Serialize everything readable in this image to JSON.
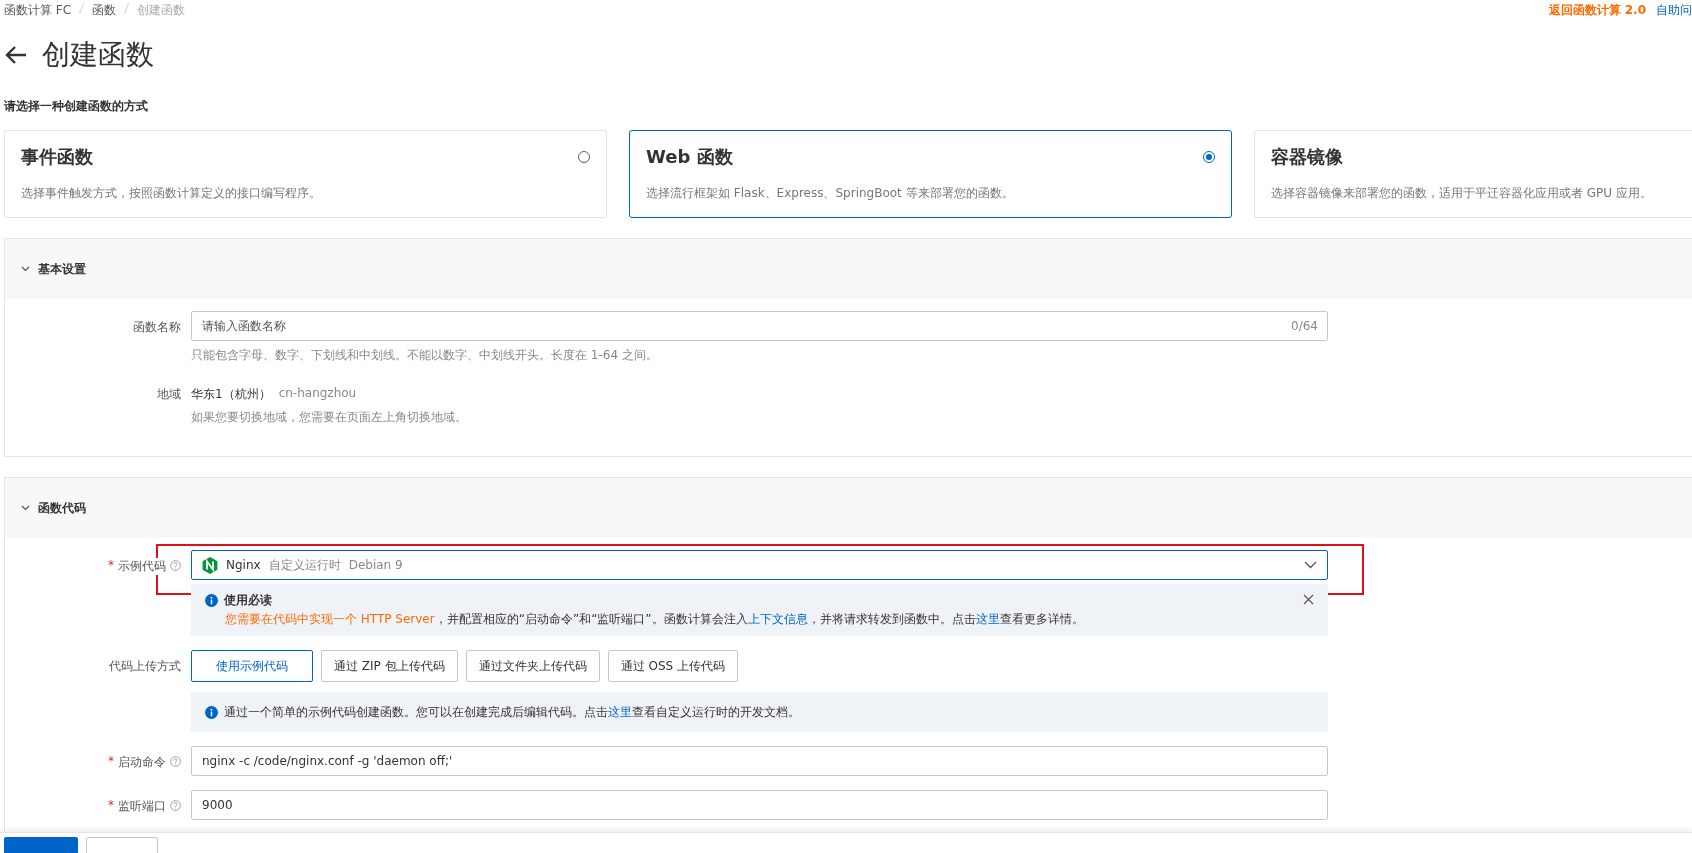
{
  "breadcrumb": [
    {
      "label": "函数计算 FC",
      "current": false
    },
    {
      "label": "函数",
      "current": false
    },
    {
      "label": "创建函数",
      "current": true
    }
  ],
  "header_links": [
    {
      "label": "返回函数计算 2.0",
      "kind": "highlight"
    },
    {
      "label": "自助问",
      "kind": "link"
    }
  ],
  "page_title": "创建函数",
  "prompt": "请选择一种创建函数的方式",
  "function_types": [
    {
      "title": "事件函数",
      "description": "选择事件触发方式，按照函数计算定义的接口编写程序。",
      "selected": false
    },
    {
      "title": "Web 函数",
      "description": "选择流行框架如 Flask、Express、SpringBoot 等来部署您的函数。",
      "selected": true
    },
    {
      "title": "容器镜像",
      "description": "选择容器镜像来部署您的函数，适用于平迁容器化应用或者 GPU 应用。",
      "selected": false
    }
  ],
  "sections": [
    {
      "title": "基本设置",
      "expanded": true,
      "fields": [
        {
          "kind": "input",
          "label": "函数名称",
          "help": false,
          "placeholder": "请输入函数名称",
          "counter": "0/64",
          "hint": "只能包含字母、数字、下划线和中划线。不能以数字、中划线开头。长度在 1-64 之间。"
        },
        {
          "kind": "static",
          "label": "地域",
          "value": "华东1（杭州）",
          "secondary": "cn-hangzhou",
          "hint": "如果您要切换地域，您需要在页面左上角切换地域。"
        }
      ]
    },
    {
      "title": "函数代码",
      "expanded": true,
      "fields": [
        {
          "kind": "select",
          "label": "示例代码",
          "required_mark": "*",
          "help": true,
          "highlighted": true,
          "value": "Nginx",
          "tags": [
            "自定义运行时",
            "Debian 9"
          ],
          "notice": {
            "title": "使用必读",
            "parts": [
              {
                "kind": "warning",
                "text": "您需要在代码中实现一个 HTTP Server"
              },
              {
                "kind": "text",
                "text": "，并配置相应的“启动命令”和“监听端口”。函数计算会注入"
              },
              {
                "kind": "link",
                "text": "上下文信息"
              },
              {
                "kind": "text",
                "text": "，并将请求转发到函数中。点击"
              },
              {
                "kind": "link",
                "text": "这里"
              },
              {
                "kind": "text",
                "text": "查看更多详情。"
              }
            ]
          }
        },
        {
          "kind": "buttons",
          "label": "代码上传方式",
          "help": false,
          "options": [
            {
              "label": "使用示例代码",
              "selected": true
            },
            {
              "label": "通过 ZIP 包上传代码",
              "selected": false
            },
            {
              "label": "通过文件夹上传代码",
              "selected": false
            },
            {
              "label": "通过 OSS 上传代码",
              "selected": false
            }
          ],
          "info": [
            {
              "kind": "text",
              "text": "通过一个简单的示例代码创建函数。您可以在创建完成后编辑代码。点击"
            },
            {
              "kind": "link",
              "text": "这里"
            },
            {
              "kind": "text",
              "text": "查看自定义运行时的开发文档。"
            }
          ]
        },
        {
          "kind": "input",
          "label": "启动命令",
          "required_mark": "*",
          "help": true,
          "value": "nginx -c /code/nginx.conf -g 'daemon off;'"
        },
        {
          "kind": "input",
          "label": "监听端口",
          "required_mark": "*",
          "help": true,
          "value": "9000"
        }
      ]
    }
  ],
  "footer": {
    "buttons": [
      {
        "kind": "primary"
      },
      {
        "kind": "default"
      }
    ]
  }
}
